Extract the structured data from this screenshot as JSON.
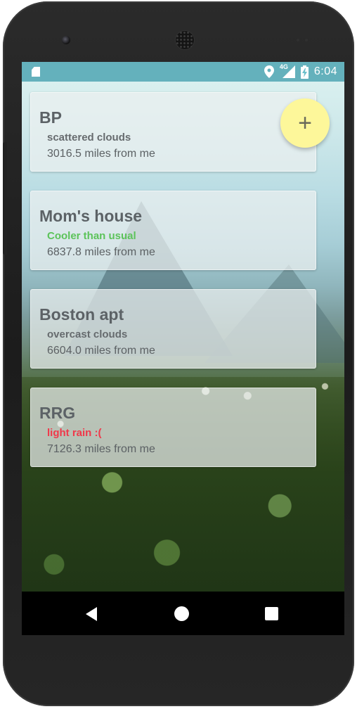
{
  "status_bar": {
    "time": "6:04",
    "network": "4G",
    "icons": [
      "sd-card-icon",
      "location-icon",
      "signal-icon",
      "battery-charging-icon"
    ]
  },
  "fab": {
    "label": "+"
  },
  "cards": [
    {
      "title": "BP",
      "condition": "scattered clouds",
      "distance": "3016.5 miles from me",
      "condition_color": "#6a6e70"
    },
    {
      "title": "Mom's house",
      "condition": "Cooler than usual",
      "distance": "6837.8 miles from me",
      "condition_color": "#5cc35a"
    },
    {
      "title": "Boston apt",
      "condition": "overcast clouds",
      "distance": "6604.0 miles from me",
      "condition_color": "#6a6e70"
    },
    {
      "title": "RRG",
      "condition": "light rain :(",
      "distance": "7126.3 miles from me",
      "condition_color": "#f0384a"
    }
  ],
  "nav_bar": {
    "icons": [
      "back-icon",
      "home-icon",
      "recents-icon"
    ]
  }
}
